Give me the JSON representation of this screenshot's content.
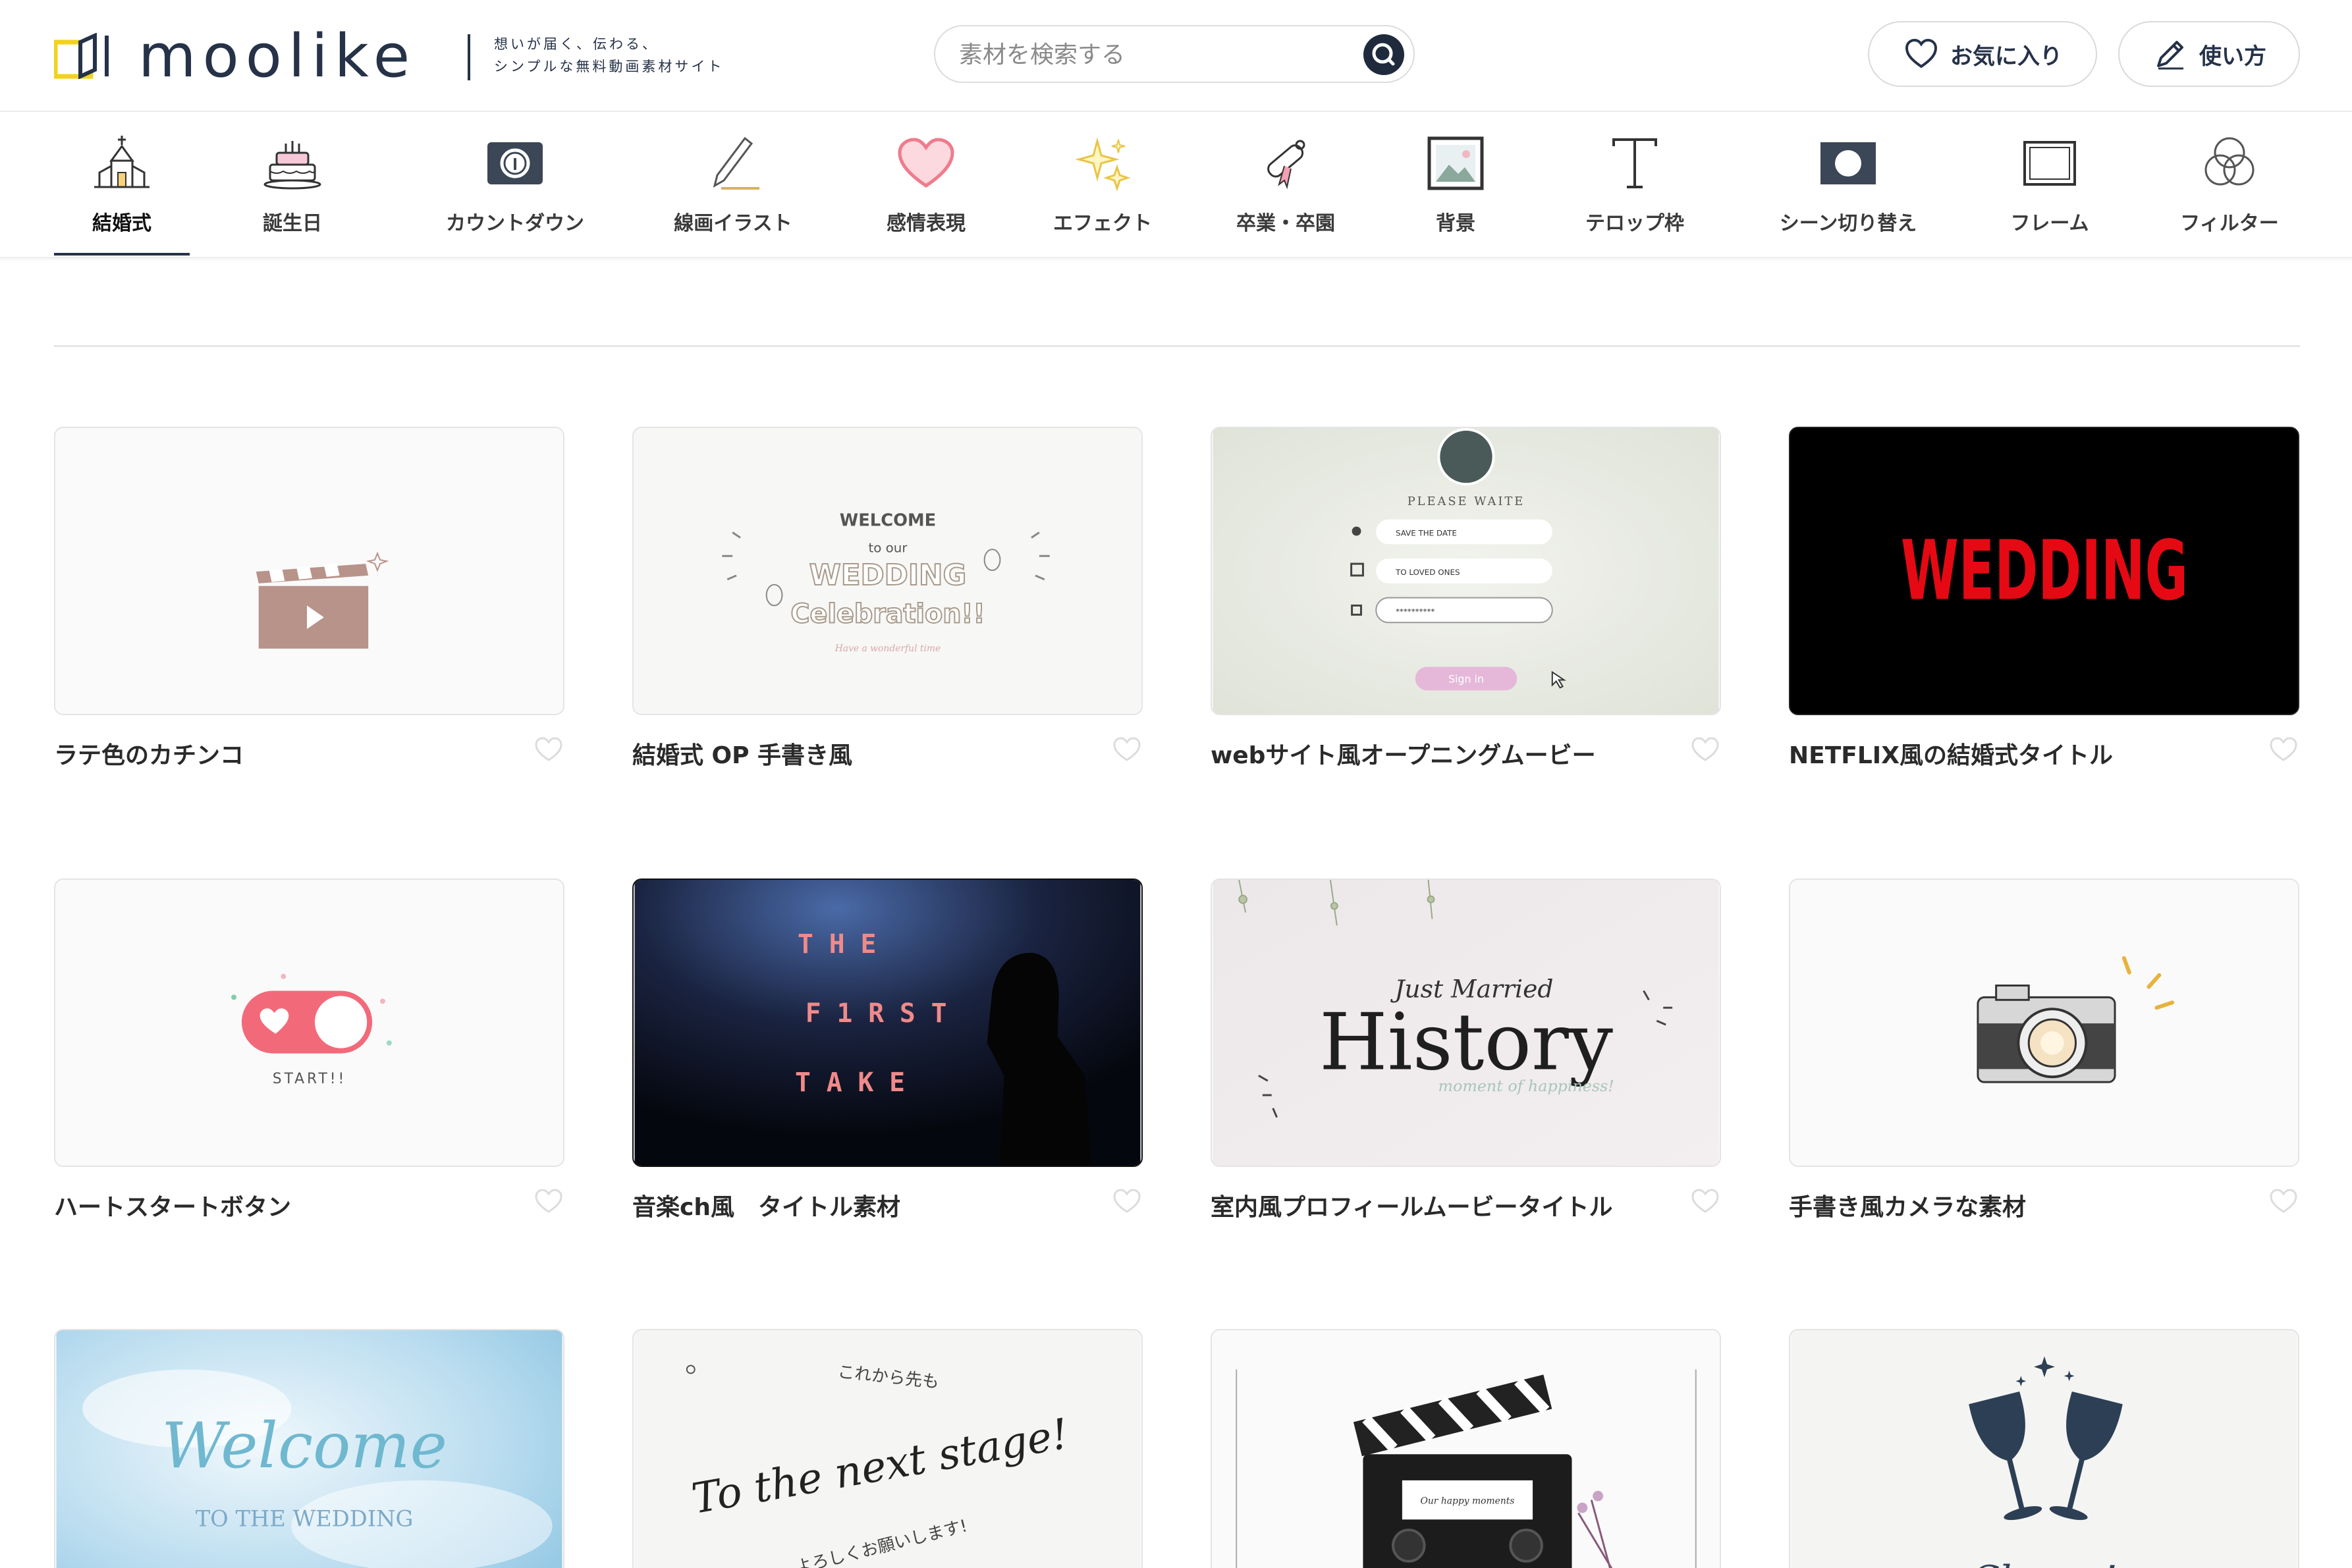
{
  "header": {
    "logo_text": "moolike",
    "tagline_line1": "想いが届く、伝わる、",
    "tagline_line2": "シンプルな無料動画素材サイト",
    "search_placeholder": "素材を検索する",
    "favorites_label": "お気に入り",
    "howto_label": "使い方"
  },
  "categories": [
    {
      "label": "結婚式",
      "icon": "church-icon",
      "active": true
    },
    {
      "label": "誕生日",
      "icon": "cake-icon"
    },
    {
      "label": "カウントダウン",
      "icon": "countdown-icon"
    },
    {
      "label": "線画イラスト",
      "icon": "pencil-icon"
    },
    {
      "label": "感情表現",
      "icon": "heart-icon"
    },
    {
      "label": "エフェクト",
      "icon": "sparkle-icon"
    },
    {
      "label": "卒業・卒園",
      "icon": "diploma-icon"
    },
    {
      "label": "背景",
      "icon": "picture-icon"
    },
    {
      "label": "テロップ枠",
      "icon": "text-t-icon"
    },
    {
      "label": "シーン切り替え",
      "icon": "scene-switch-icon"
    },
    {
      "label": "フレーム",
      "icon": "frame-icon"
    },
    {
      "label": "フィルター",
      "icon": "filter-icon"
    }
  ],
  "cards": [
    {
      "title": "ラテ色のカチンコ"
    },
    {
      "title": "結婚式 OP 手書き風",
      "thumb": {
        "l1": "WELCOME",
        "l2": "to our",
        "l3": "WEDDING",
        "l4": "Celebration!!"
      }
    },
    {
      "title": "webサイト風オープニングムービー",
      "thumb": {
        "header": "PLEASE WAITE",
        "f1": "SAVE THE DATE",
        "f2": "TO LOVED ONES",
        "f3": "**********",
        "button": "Sign in"
      }
    },
    {
      "title": "NETFLIX風の結婚式タイトル",
      "thumb": {
        "text": "WEDDING"
      }
    },
    {
      "title": "ハートスタートボタン",
      "thumb": {
        "text": "START!!"
      }
    },
    {
      "title": "音楽ch風　タイトル素材",
      "thumb": {
        "l1": "T  H  E",
        "l2": "F  1  R  S  T",
        "l3": "T  A  K  E"
      }
    },
    {
      "title": "室内風プロフィールムービータイトル",
      "thumb": {
        "script": "Just Married",
        "main": "History",
        "sub": "moment of happiness!"
      }
    },
    {
      "title": "手書き風カメラな素材"
    },
    {
      "title": "",
      "thumb": {
        "script": "Welcome",
        "sub": "TO THE WEDDING"
      }
    },
    {
      "title": "",
      "thumb": {
        "top": "これから先も",
        "script": "To the next stage!",
        "bottom": "よろしくお願いします!"
      }
    },
    {
      "title": "",
      "thumb": {
        "label": "Our happy moments"
      }
    },
    {
      "title": "",
      "thumb": {
        "script": "Cheers!"
      }
    }
  ],
  "colors": {
    "navy": "#253248",
    "netflix_red": "#e50914",
    "toggle_pink": "#f26a7a",
    "latte": "#b8938a"
  }
}
